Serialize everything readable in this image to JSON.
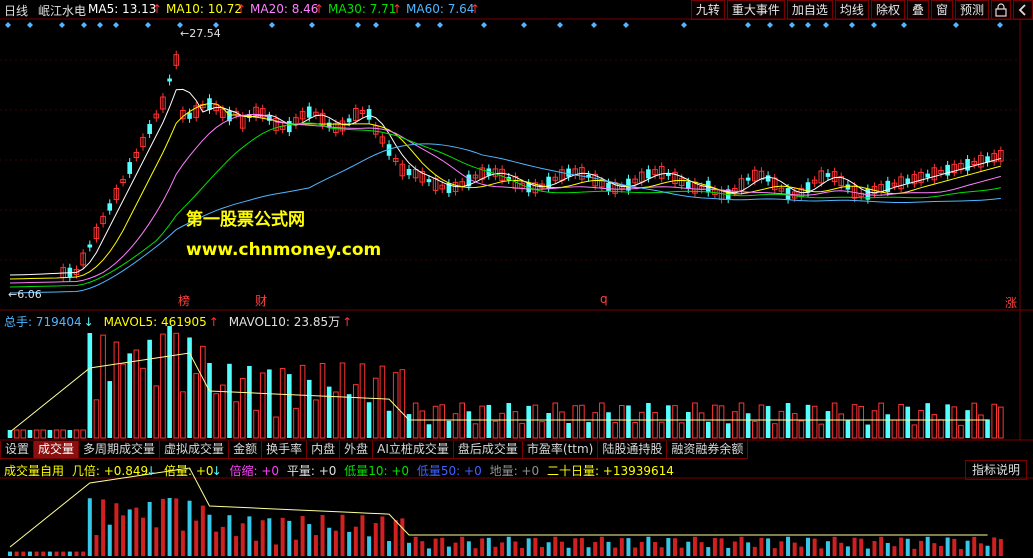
{
  "header": {
    "period": "日线",
    "stock_name": "岷江水电",
    "ma5": "MA5: 13.13",
    "ma10": "MA10: 10.72",
    "ma20": "MA20: 8.46",
    "ma30": "MA30: 7.71",
    "ma60": "MA60: 7.64",
    "up_arrow": "↑"
  },
  "toolbar": {
    "buttons": [
      "九转",
      "重大事件",
      "加自选",
      "均线",
      "除权",
      "叠",
      "窗",
      "预测"
    ],
    "lock_icon": "lock-icon",
    "back_icon": "arrow-left-icon"
  },
  "price_chart": {
    "high_label": "27.54",
    "low_label": "6.06",
    "markers": [
      "榜",
      "财",
      "q",
      "涨"
    ]
  },
  "watermark": {
    "line1": "第一股票公式网",
    "line2": "www.chnmoney.com"
  },
  "volume": {
    "total": "总手: 719404",
    "down_arrow": "↓",
    "up_arrow": "↑",
    "mavol5": "MAVOL5: 461905",
    "mavol10": "MAVOL10: 23.85万"
  },
  "tabs": [
    "设置",
    "成交量",
    "多周期成交量",
    "虚拟成交量",
    "金额",
    "换手率",
    "内盘",
    "外盘",
    "AI立桩成交量",
    "盘后成交量",
    "市盈率(ttm)",
    "陆股通持股",
    "融资融券余额"
  ],
  "indicator": {
    "name": "成交量自用",
    "jibei": "几倍: +0.849",
    "beiliang": "倍量: +0",
    "beisuo": "倍缩: +0",
    "pingliang": "平量: +0",
    "diliang10": "低量10: +0",
    "diliang50": "低量50: +0",
    "diliang": "地量: +0",
    "ershiri": "二十日量: +13939614",
    "explain_button": "指标说明"
  },
  "colors": {
    "up": "#ff3333",
    "down": "#54ffff",
    "ma5": "#ffffff",
    "ma10": "#ffff00",
    "ma20": "#ff80ff",
    "ma30": "#00e000",
    "ma60": "#4fb6ff",
    "grid": "#7a0000"
  }
}
